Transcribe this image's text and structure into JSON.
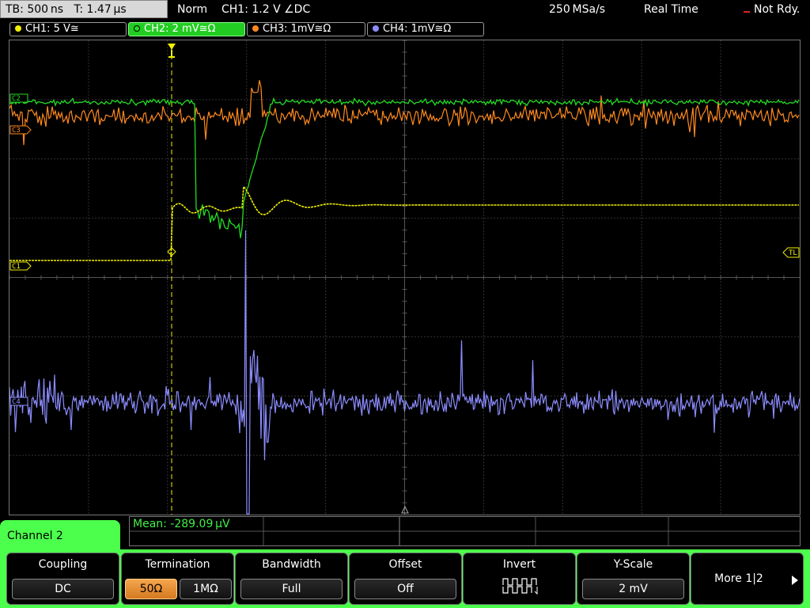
{
  "status": {
    "timebase": "TB: 500 ns",
    "trigger_time": "T: 1.47 µs",
    "mode": "Norm",
    "trigger": "CH1: 1.2 V ∠DC",
    "sample_rate": "250 MSa/s",
    "acq_mode": "Real Time",
    "state": "Not Rdy."
  },
  "channels": [
    {
      "label": "CH1: 5 V≅",
      "color": "#f0f000"
    },
    {
      "label": "CH2: 2 mV≅Ω",
      "color": "#22dd22"
    },
    {
      "label": "CH3: 1mV≅Ω",
      "color": "#ff8a1e"
    },
    {
      "label": "CH4: 1mV≅Ω",
      "color": "#8c8cff"
    }
  ],
  "markers": {
    "c3": "C3",
    "c1": "C1",
    "c4": "C4",
    "c2": "C2",
    "tl": "TL"
  },
  "measurement": {
    "mean_text": "Mean: -289.09 µV"
  },
  "menu": {
    "title": "Channel 2",
    "coupling": {
      "label": "Coupling",
      "value": "DC"
    },
    "termination": {
      "label": "Termination",
      "options": [
        "50Ω",
        "1MΩ"
      ],
      "selected": "50Ω"
    },
    "bandwidth": {
      "label": "Bandwidth",
      "value": "Full"
    },
    "offset": {
      "label": "Offset",
      "value": "Off"
    },
    "invert": {
      "label": "Invert",
      "icon": "invert-waveform-icon"
    },
    "yscale": {
      "label": "Y-Scale",
      "value": "2 mV"
    },
    "more": {
      "label": "More 1|2"
    }
  }
}
